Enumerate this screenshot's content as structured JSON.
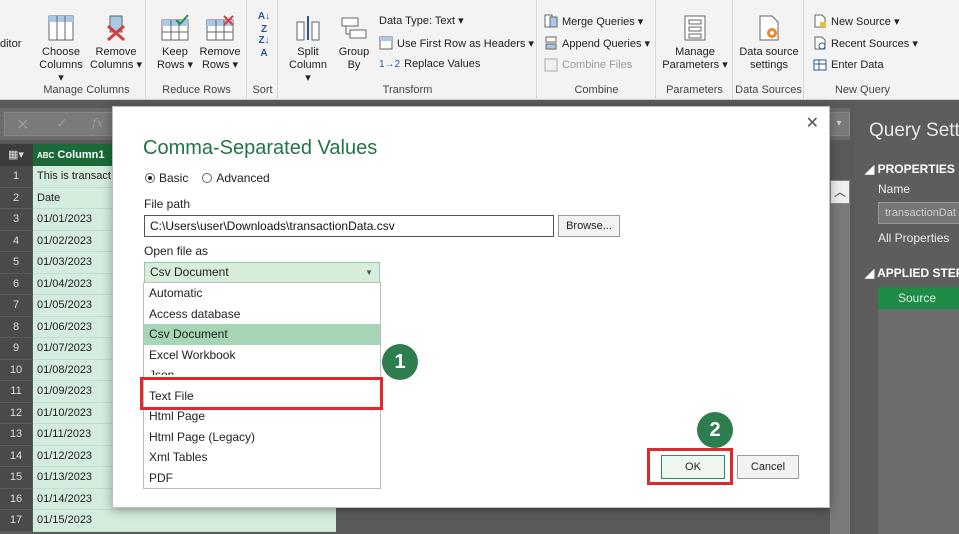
{
  "ribbon": {
    "editor_fragment": "ditor",
    "groups": {
      "manage_columns": {
        "label": "Manage Columns",
        "choose_columns": [
          "Choose",
          "Columns ▾"
        ],
        "remove_columns": [
          "Remove",
          "Columns ▾"
        ]
      },
      "reduce_rows": {
        "label": "Reduce Rows",
        "keep_rows": [
          "Keep",
          "Rows ▾"
        ],
        "remove_rows": [
          "Remove",
          "Rows ▾"
        ]
      },
      "sort": {
        "label": "Sort"
      },
      "transform": {
        "label": "Transform",
        "split_column": [
          "Split",
          "Column ▾"
        ],
        "group_by": [
          "Group",
          "By"
        ],
        "data_type": "Data Type: Text ▾",
        "use_first_row": "Use First Row as Headers ▾",
        "replace_values": "Replace Values"
      },
      "combine": {
        "label": "Combine",
        "merge_queries": "Merge Queries ▾",
        "append_queries": "Append Queries ▾",
        "combine_files": "Combine Files"
      },
      "parameters": {
        "label": "Parameters",
        "manage_parameters": [
          "Manage",
          "Parameters ▾"
        ]
      },
      "data_sources": {
        "label": "Data Sources",
        "data_source_settings": [
          "Data source",
          "settings"
        ]
      },
      "new_query": {
        "label": "New Query",
        "new_source": "New Source ▾",
        "recent_sources": "Recent Sources ▾",
        "enter_data": "Enter Data"
      }
    }
  },
  "grid": {
    "column_header": "Column1",
    "type_icon": "ABC",
    "rows": [
      {
        "n": "1",
        "v": "This is transact"
      },
      {
        "n": "2",
        "v": "Date"
      },
      {
        "n": "3",
        "v": "01/01/2023"
      },
      {
        "n": "4",
        "v": "01/02/2023"
      },
      {
        "n": "5",
        "v": "01/03/2023"
      },
      {
        "n": "6",
        "v": "01/04/2023"
      },
      {
        "n": "7",
        "v": "01/05/2023"
      },
      {
        "n": "8",
        "v": "01/06/2023"
      },
      {
        "n": "9",
        "v": "01/07/2023"
      },
      {
        "n": "10",
        "v": "01/08/2023"
      },
      {
        "n": "11",
        "v": "01/09/2023"
      },
      {
        "n": "12",
        "v": "01/10/2023"
      },
      {
        "n": "13",
        "v": "01/11/2023"
      },
      {
        "n": "14",
        "v": "01/12/2023"
      },
      {
        "n": "15",
        "v": "01/13/2023"
      },
      {
        "n": "16",
        "v": "01/14/2023"
      },
      {
        "n": "17",
        "v": "01/15/2023"
      }
    ]
  },
  "query_settings": {
    "title": "Query Sett",
    "properties": "PROPERTIES",
    "name_label": "Name",
    "name_value": "transactionDat",
    "all_properties": "All Properties",
    "applied_steps": "APPLIED STEP",
    "steps": [
      "Source"
    ]
  },
  "dialog": {
    "title": "Comma-Separated Values",
    "mode_basic": "Basic",
    "mode_advanced": "Advanced",
    "file_path_label": "File path",
    "file_path_value": "C:\\Users\\user\\Downloads\\transactionData.csv",
    "browse": "Browse...",
    "open_as_label": "Open file as",
    "open_as_value": "Csv Document",
    "options": [
      "Automatic",
      "Access database",
      "Csv Document",
      "Excel Workbook",
      "Json",
      "Text File",
      "Html Page",
      "Html Page (Legacy)",
      "Xml Tables",
      "PDF"
    ],
    "selected_option": "Csv Document",
    "ok": "OK",
    "cancel": "Cancel"
  },
  "annotations": {
    "step1": "1",
    "step2": "2",
    "accent": "#e0292d",
    "badge_color": "#2e7d4f"
  },
  "colors": {
    "excel_green": "#227446",
    "selection_green": "#a6d6b5"
  }
}
